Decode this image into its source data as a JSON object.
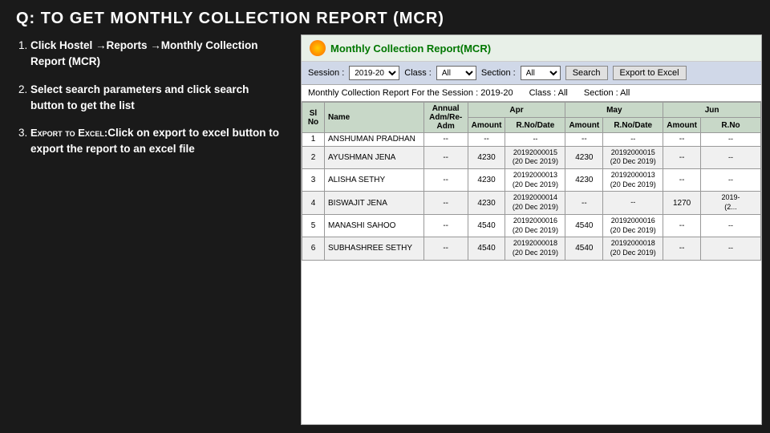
{
  "page": {
    "title": "Q: TO GET MONTHLY COLLECTION REPORT (MCR)"
  },
  "left": {
    "steps": [
      {
        "number": "1.",
        "bold_text": "Click Hostel →Reports →Monthly Collection Report (MCR)"
      },
      {
        "number": "2.",
        "bold_text": "Select search parameters and click search button  to get the list"
      },
      {
        "number": "3.",
        "prefix": "Export to Excel:",
        "bold_text": "Click on export to excel button to export the report to an excel file"
      }
    ]
  },
  "report": {
    "icon_alt": "report-icon",
    "title": "Monthly Collection Report(MCR)",
    "filters": {
      "session_label": "Session :",
      "session_value": "2019-20",
      "class_label": "Class :",
      "class_value": "All",
      "section_label": "Section :",
      "section_value": "All",
      "search_btn": "Search",
      "export_btn": "Export to Excel"
    },
    "info_bar": {
      "session_text": "Monthly Collection Report For the Session : 2019-20",
      "class_text": "Class : All",
      "section_text": "Section : All"
    },
    "table": {
      "headers": [
        "Sl No",
        "Name",
        "Annual Adm/Re-Adm",
        "Apr Amount",
        "Apr R.No/Date",
        "May Amount",
        "May R.No/Date",
        "Jun Amount",
        "Jun R.No"
      ],
      "col_headers_row1": [
        "",
        "",
        "Annual Adm/Re-Adm",
        "Apr",
        "",
        "May",
        "",
        "Jun",
        ""
      ],
      "col_headers_row2": [
        "Sl No",
        "Name",
        "",
        "Amount",
        "R.No/Date",
        "Amount",
        "R.No/Date",
        "Amount",
        "R.No"
      ],
      "rows": [
        {
          "slno": "1",
          "name": "ANSHUMAN PRADHAN",
          "annual": "--",
          "apr_amount": "--",
          "apr_rndate": "--",
          "may_amount": "--",
          "may_rndate": "--",
          "jun_amount": "--",
          "jun_rno": "--"
        },
        {
          "slno": "2",
          "name": "AYUSHMAN JENA",
          "annual": "--",
          "apr_amount": "4230",
          "apr_rndate": "20192000015\n(20 Dec 2019)",
          "may_amount": "4230",
          "may_rndate": "20192000015\n(20 Dec 2019)",
          "jun_amount": "--",
          "jun_rno": "--"
        },
        {
          "slno": "3",
          "name": "ALISHA SETHY",
          "annual": "--",
          "apr_amount": "4230",
          "apr_rndate": "20192000013\n(20 Dec 2019)",
          "may_amount": "4230",
          "may_rndate": "20192000013\n(20 Dec 2019)",
          "jun_amount": "--",
          "jun_rno": "--"
        },
        {
          "slno": "4",
          "name": "BISWAJIT JENA",
          "annual": "--",
          "apr_amount": "4230",
          "apr_rndate": "20192000014\n(20 Dec 2019)",
          "may_amount": "--",
          "may_rndate": "--",
          "jun_amount": "1270",
          "jun_rno": "2019-\n(2..."
        },
        {
          "slno": "5",
          "name": "MANASHI SAHOO",
          "annual": "--",
          "apr_amount": "4540",
          "apr_rndate": "20192000016\n(20 Dec 2019)",
          "may_amount": "4540",
          "may_rndate": "20192000016\n(20 Dec 2019)",
          "jun_amount": "--",
          "jun_rno": "--"
        },
        {
          "slno": "6",
          "name": "SUBHASHREE SETHY",
          "annual": "--",
          "apr_amount": "4540",
          "apr_rndate": "20192000018\n(20 Dec 2019)",
          "may_amount": "4540",
          "may_rndate": "20192000018\n(20 Dec 2019)",
          "jun_amount": "--",
          "jun_rno": "--"
        }
      ]
    }
  }
}
